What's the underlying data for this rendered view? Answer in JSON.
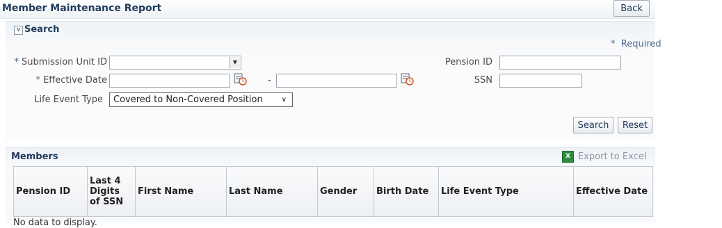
{
  "header": {
    "title": "Member Maintenance Report",
    "back_label": "Back"
  },
  "search": {
    "title": "Search",
    "required_star": "*",
    "required_text": "Required",
    "submission_unit_label": "Submission Unit ID",
    "effective_date_label": "Effective Date",
    "date_range_separator": "-",
    "life_event_label": "Life Event Type",
    "life_event_value": "Covered to Non-Covered Position",
    "pension_id_label": "Pension ID",
    "ssn_label": "SSN",
    "search_button": "Search",
    "reset_button": "Reset"
  },
  "members": {
    "title": "Members",
    "export_label": "Export to Excel",
    "columns": [
      "Pension ID",
      "Last 4 Digits of SSN",
      "First Name",
      "Last Name",
      "Gender",
      "Birth Date",
      "Life Event Type",
      "Effective Date"
    ],
    "empty_text": "No data to display."
  }
}
